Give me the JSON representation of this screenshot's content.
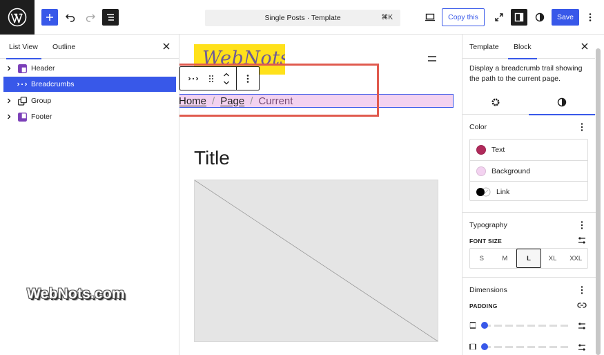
{
  "toolbar": {
    "command_bar": "Single Posts · Template",
    "command_shortcut": "⌘K",
    "copy_label": "Copy this",
    "save_label": "Save"
  },
  "left_panel": {
    "tabs": [
      {
        "label": "List View",
        "active": true
      },
      {
        "label": "Outline",
        "active": false
      }
    ],
    "tree": [
      {
        "label": "Header",
        "icon": "header-block-icon",
        "has_children": true,
        "selected": false
      },
      {
        "label": "Breadcrumbs",
        "icon": "breadcrumbs-block-icon",
        "has_children": false,
        "selected": true
      },
      {
        "label": "Group",
        "icon": "group-block-icon",
        "has_children": true,
        "selected": false
      },
      {
        "label": "Footer",
        "icon": "footer-block-icon",
        "has_children": true,
        "selected": false
      }
    ]
  },
  "watermark": "WebNots.com",
  "canvas": {
    "site_logo_text": "WebNots",
    "breadcrumbs": {
      "home": "Home",
      "page": "Page",
      "current": "Current",
      "separator": "/"
    },
    "post_title": "Title"
  },
  "right_panel": {
    "tabs": [
      {
        "label": "Template",
        "active": false
      },
      {
        "label": "Block",
        "active": true
      }
    ],
    "description": "Display a breadcrumb trail showing the path to the current page.",
    "sub_tabs": [
      {
        "icon": "gear-icon",
        "active": false
      },
      {
        "icon": "styles-half-circle-icon",
        "active": true
      }
    ],
    "color": {
      "title": "Color",
      "items": [
        {
          "label": "Text",
          "swatch": "#b02a5b"
        },
        {
          "label": "Background",
          "swatch": "#f3d2f0"
        },
        {
          "label": "Link",
          "swatch": "#000000"
        }
      ]
    },
    "typography": {
      "title": "Typography",
      "font_size_label": "FONT SIZE",
      "sizes": [
        "S",
        "M",
        "L",
        "XL",
        "XXL"
      ],
      "selected_size": "L"
    },
    "dimensions": {
      "title": "Dimensions",
      "padding_label": "PADDING"
    }
  },
  "colors": {
    "accent": "#3858e9",
    "highlight_frame": "#e05a4e",
    "logo_bg": "#ffe11a"
  }
}
